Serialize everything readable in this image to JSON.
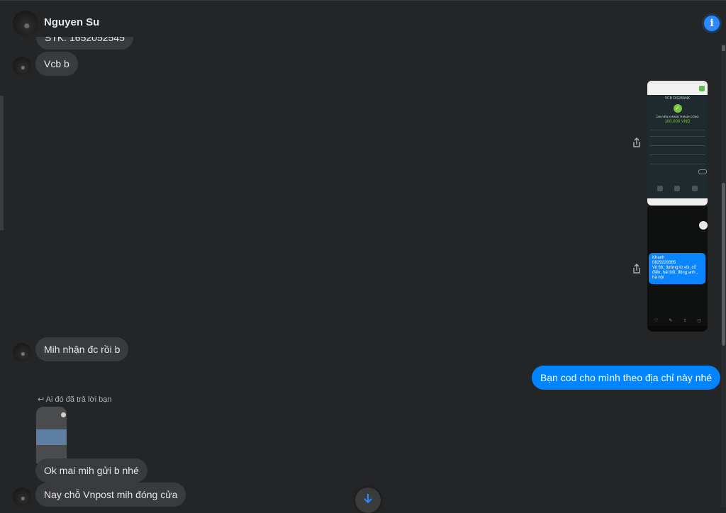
{
  "header": {
    "contact_name": "Nguyen Su",
    "info_icon": "info-icon"
  },
  "messages": {
    "truncated_top": "STK: 1652052545",
    "vcb": "Vcb b",
    "received": "Mih nhận đc rồi b",
    "outgoing": "Bạn cod cho mình theo địa chỉ này nhé",
    "reply_note": "Ai đó đã trả lời bạn",
    "ok": "Ok mai mih gửi b nhé",
    "closed": "Nay chỗ Vnpost mih đóng cửa"
  },
  "screenshot_1": {
    "brand": "VCB DIGIBANK",
    "status": "CHUYỂN KHOẢN THÀNH CÔNG",
    "amount": "100,000 VND"
  },
  "screenshot_2": {
    "name": "Khanh",
    "phone": "0829229385",
    "address": "Vit 68, đường lò vôi, cổ điển, hải bối, đông anh , hà nội"
  },
  "colors": {
    "accent": "#0084ff",
    "bubble_in": "#3a3b3c",
    "background": "#242526"
  }
}
